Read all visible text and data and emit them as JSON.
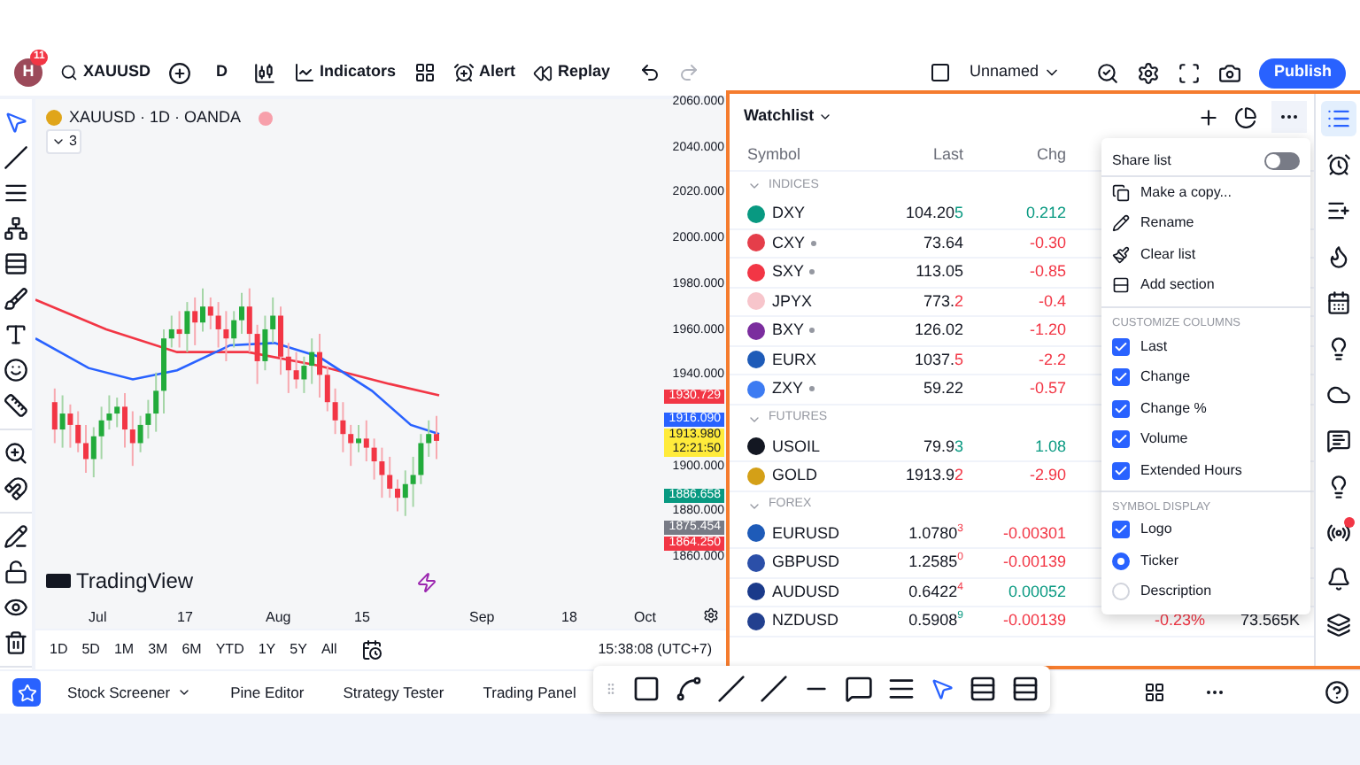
{
  "topbar": {
    "avatar": "H",
    "notifications": "11",
    "symbol": "XAUUSD",
    "interval": "D",
    "indicators": "Indicators",
    "alert": "Alert",
    "replay": "Replay",
    "layout_name": "Unnamed",
    "publish": "Publish"
  },
  "left_tools": [
    {
      "selected": true
    },
    {
      "selected": false
    },
    {
      "selected": false
    },
    {
      "selected": false
    },
    {
      "selected": false
    },
    {
      "selected": false
    },
    {
      "selected": false
    },
    {
      "selected": false
    },
    {
      "selected": false
    },
    {
      "selected": false
    },
    {
      "selected": false
    },
    {
      "selected": false
    },
    {
      "selected": false
    },
    {
      "selected": false
    },
    {
      "selected": false
    }
  ],
  "chart": {
    "title": "XAUUSD · 1D · OANDA",
    "indicator_count": "3",
    "brand": "TradingView",
    "price_labels": [
      "2060.000",
      "2040.000",
      "2020.000",
      "2000.000",
      "1980.000",
      "1960.000",
      "1940.000",
      "1900.000",
      "1880.000",
      "1860.000"
    ],
    "price_tags": [
      {
        "lines": [
          "1930.729"
        ],
        "color": "#f23645"
      },
      {
        "lines": [
          "1916.090"
        ],
        "color": "#2962ff"
      },
      {
        "lines": [
          "1913.980",
          "12:21:50"
        ],
        "color": "#ffeb3b"
      },
      {
        "lines": [
          "1886.658"
        ],
        "color": "#089981"
      },
      {
        "lines": [
          "1875.454"
        ],
        "color": "#787b86"
      },
      {
        "lines": [
          "1864.250"
        ],
        "color": "#f23645"
      }
    ],
    "time_labels": [
      "Jul",
      "17",
      "Aug",
      "15",
      "Sep",
      "18",
      "Oct"
    ],
    "ranges": [
      "1D",
      "5D",
      "1M",
      "3M",
      "6M",
      "YTD",
      "1Y",
      "5Y",
      "All"
    ],
    "clock": "15:38:08 (UTC+7)"
  },
  "bottom_tabs": [
    {
      "label": "Stock Screener",
      "dropdown": true
    },
    {
      "label": "Pine Editor",
      "dropdown": false
    },
    {
      "label": "Strategy Tester",
      "dropdown": false
    },
    {
      "label": "Trading Panel",
      "dropdown": false
    }
  ],
  "watchlist": {
    "title": "Watchlist",
    "columns": [
      "Symbol",
      "Last",
      "Chg"
    ],
    "sections": [
      {
        "name": "INDICES",
        "rows": [
          {
            "symbol": "DXY",
            "color": "#089981",
            "delayed": false,
            "last": "104.20",
            "tick": "5",
            "tick_up": true,
            "tick_small": false,
            "chg": "0.212",
            "positive": true
          },
          {
            "symbol": "CXY",
            "color": "#e53e4a",
            "delayed": true,
            "last": "73.64",
            "chg": "-0.30",
            "positive": false
          },
          {
            "symbol": "SXY",
            "color": "#f23645",
            "delayed": true,
            "last": "113.05",
            "chg": "-0.85",
            "positive": false
          },
          {
            "symbol": "JPYX",
            "color": "#f7c5cb",
            "delayed": false,
            "last": "773.",
            "tick": "2",
            "tick_up": false,
            "tick_small": false,
            "chg": "-0.4",
            "positive": false
          },
          {
            "symbol": "BXY",
            "color": "#7b2d9e",
            "delayed": true,
            "last": "126.02",
            "chg": "-1.20",
            "positive": false
          },
          {
            "symbol": "EURX",
            "color": "#1e5bb8",
            "delayed": false,
            "last": "1037.",
            "tick": "5",
            "tick_up": false,
            "tick_small": false,
            "chg": "-2.2",
            "positive": false
          },
          {
            "symbol": "ZXY",
            "color": "#3d7bf2",
            "delayed": true,
            "last": "59.22",
            "chg": "-0.57",
            "positive": false
          }
        ]
      },
      {
        "name": "FUTURES",
        "rows": [
          {
            "symbol": "USOIL",
            "color": "#131722",
            "delayed": false,
            "last": "79.9",
            "tick": "3",
            "tick_up": true,
            "tick_small": false,
            "chg": "1.08",
            "positive": true
          },
          {
            "symbol": "GOLD",
            "color": "#d4a017",
            "delayed": false,
            "last": "1913.9",
            "tick": "2",
            "tick_up": false,
            "tick_small": false,
            "chg": "-2.90",
            "positive": false
          }
        ]
      },
      {
        "name": "FOREX",
        "rows": [
          {
            "symbol": "EURUSD",
            "color": "#1e5bb8",
            "delayed": false,
            "last": "1.0780",
            "tick": "3",
            "tick_up": false,
            "tick_small": true,
            "chg": "-0.00301",
            "positive": false
          },
          {
            "symbol": "GBPUSD",
            "color": "#2b4fa8",
            "delayed": false,
            "last": "1.2585",
            "tick": "0",
            "tick_up": false,
            "tick_small": true,
            "chg": "-0.00139",
            "positive": false
          },
          {
            "symbol": "AUDUSD",
            "color": "#1a3a8a",
            "delayed": false,
            "last": "0.6422",
            "tick": "4",
            "tick_up": false,
            "tick_small": true,
            "chg": "0.00052",
            "positive": true
          },
          {
            "symbol": "NZDUSD",
            "color": "#22408f",
            "delayed": false,
            "last": "0.5908",
            "tick": "9",
            "tick_up": true,
            "tick_small": true,
            "chg": "-0.00139",
            "positive": false,
            "chg_pct": "-0.23%",
            "volume": "73.565K"
          }
        ]
      }
    ]
  },
  "menu": {
    "share_list": {
      "label": "Share list",
      "on": false
    },
    "actions": [
      "Make a copy...",
      "Rename",
      "Clear list",
      "Add section"
    ],
    "columns_title": "CUSTOMIZE COLUMNS",
    "columns": [
      {
        "label": "Last",
        "checked": true
      },
      {
        "label": "Change",
        "checked": true
      },
      {
        "label": "Change %",
        "checked": true
      },
      {
        "label": "Volume",
        "checked": true
      },
      {
        "label": "Extended Hours",
        "checked": true
      }
    ],
    "display_title": "SYMBOL DISPLAY",
    "display": [
      {
        "label": "Logo",
        "kind": "checkbox",
        "checked": true
      },
      {
        "label": "Ticker",
        "kind": "radio",
        "selected": true
      },
      {
        "label": "Description",
        "kind": "radio",
        "selected": false
      }
    ]
  },
  "right_tools": [
    {
      "selected": true,
      "badge": false
    },
    {
      "selected": false,
      "badge": false
    },
    {
      "selected": false,
      "badge": false
    },
    {
      "selected": false,
      "badge": false
    },
    {
      "selected": false,
      "badge": false
    },
    {
      "selected": false,
      "badge": false
    },
    {
      "selected": false,
      "badge": false
    },
    {
      "selected": false,
      "badge": false
    },
    {
      "selected": false,
      "badge": false
    },
    {
      "selected": false,
      "badge": true
    },
    {
      "selected": false,
      "badge": false
    },
    {
      "selected": false,
      "badge": false
    }
  ]
}
